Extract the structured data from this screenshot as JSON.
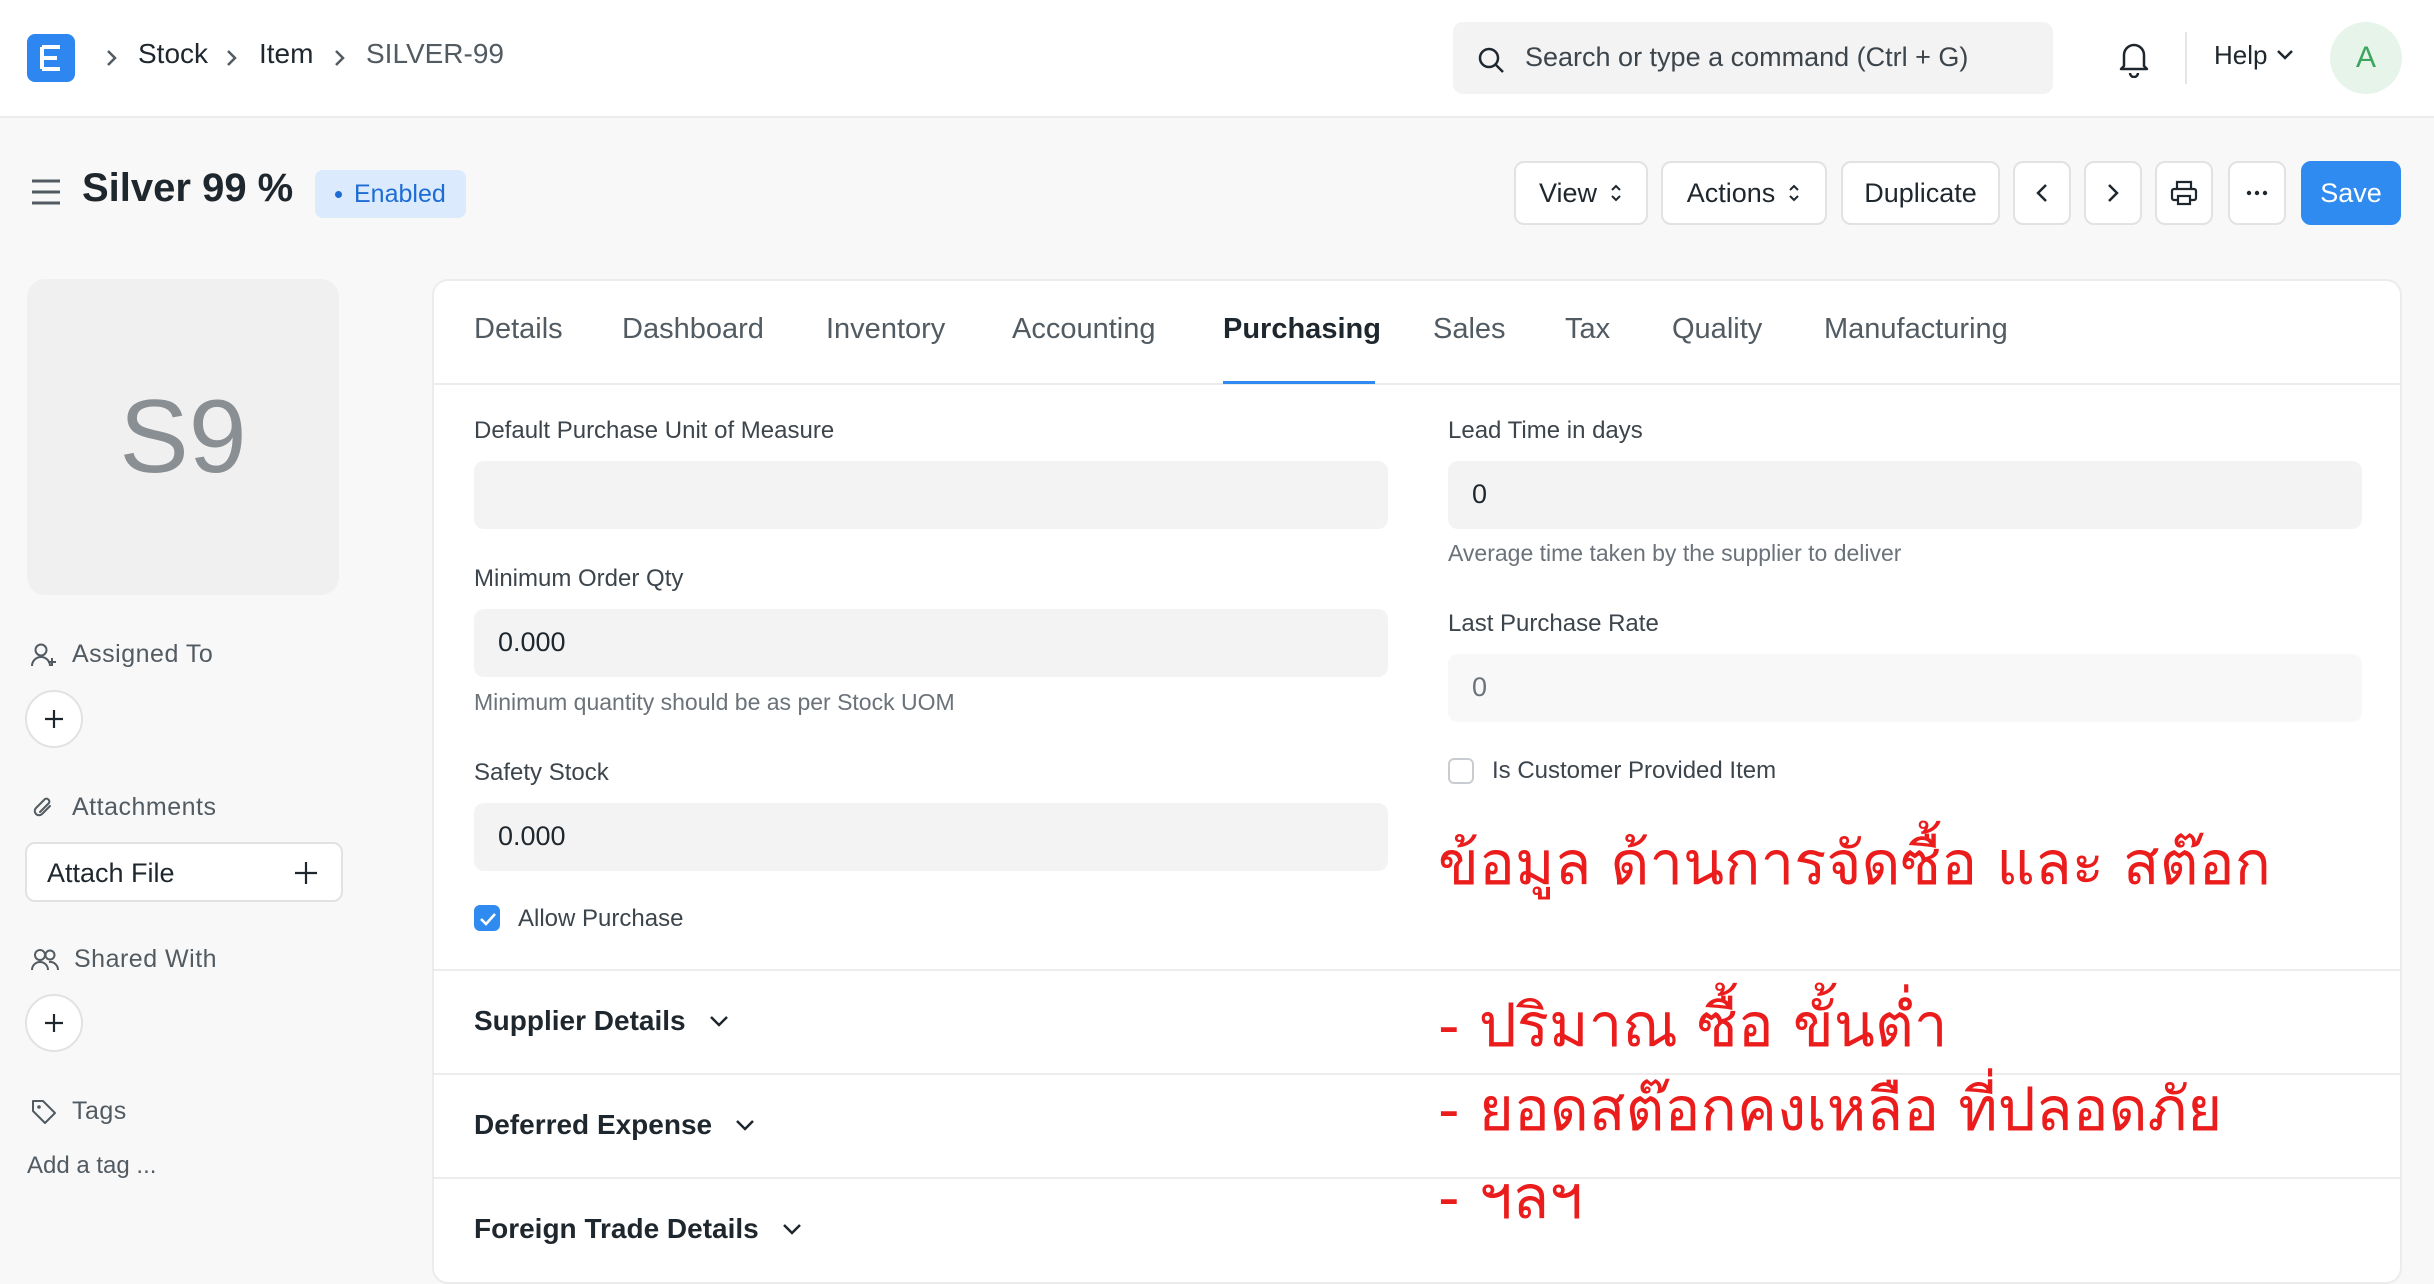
{
  "navbar": {
    "logo_letter": "E",
    "breadcrumbs": [
      "Stock",
      "Item",
      "SILVER-99"
    ],
    "search_placeholder": "Search or type a command (Ctrl + G)",
    "help_label": "Help",
    "avatar_initial": "A"
  },
  "page": {
    "title": "Silver 99 %",
    "status": "Enabled",
    "buttons": {
      "view": "View",
      "actions": "Actions",
      "duplicate": "Duplicate",
      "save": "Save"
    }
  },
  "sidebar": {
    "image_initials": "S9",
    "assigned_to": "Assigned To",
    "attachments": "Attachments",
    "attach_file": "Attach File",
    "shared_with": "Shared With",
    "tags": "Tags",
    "add_tag": "Add a tag ..."
  },
  "tabs": [
    "Details",
    "Dashboard",
    "Inventory",
    "Accounting",
    "Purchasing",
    "Sales",
    "Tax",
    "Quality",
    "Manufacturing"
  ],
  "active_tab": "Purchasing",
  "form": {
    "default_purchase_uom": {
      "label": "Default Purchase Unit of Measure",
      "value": ""
    },
    "minimum_order_qty": {
      "label": "Minimum Order Qty",
      "value": "0.000",
      "help": "Minimum quantity should be as per Stock UOM"
    },
    "safety_stock": {
      "label": "Safety Stock",
      "value": "0.000"
    },
    "allow_purchase": {
      "label": "Allow Purchase",
      "checked": true
    },
    "lead_time_days": {
      "label": "Lead Time in days",
      "value": "0",
      "help": "Average time taken by the supplier to deliver"
    },
    "last_purchase_rate": {
      "label": "Last Purchase Rate",
      "value": "0"
    },
    "is_customer_provided_item": {
      "label": "Is Customer Provided Item",
      "checked": false
    }
  },
  "sections": [
    "Supplier Details",
    "Deferred Expense",
    "Foreign Trade Details"
  ],
  "annotation": {
    "title": "ข้อมูล ด้านการจัดซื้อ และ สต๊อก",
    "lines": [
      "- ปริมาณ ซื้อ ขั้นต่ำ",
      "- ยอดสต๊อกคงเหลือ ที่ปลอดภัย",
      "- ฯลฯ"
    ]
  },
  "colors": {
    "primary": "#2f8bef",
    "annotation_red": "#ea1c1c",
    "enabled_badge_bg": "#dbeafd"
  }
}
